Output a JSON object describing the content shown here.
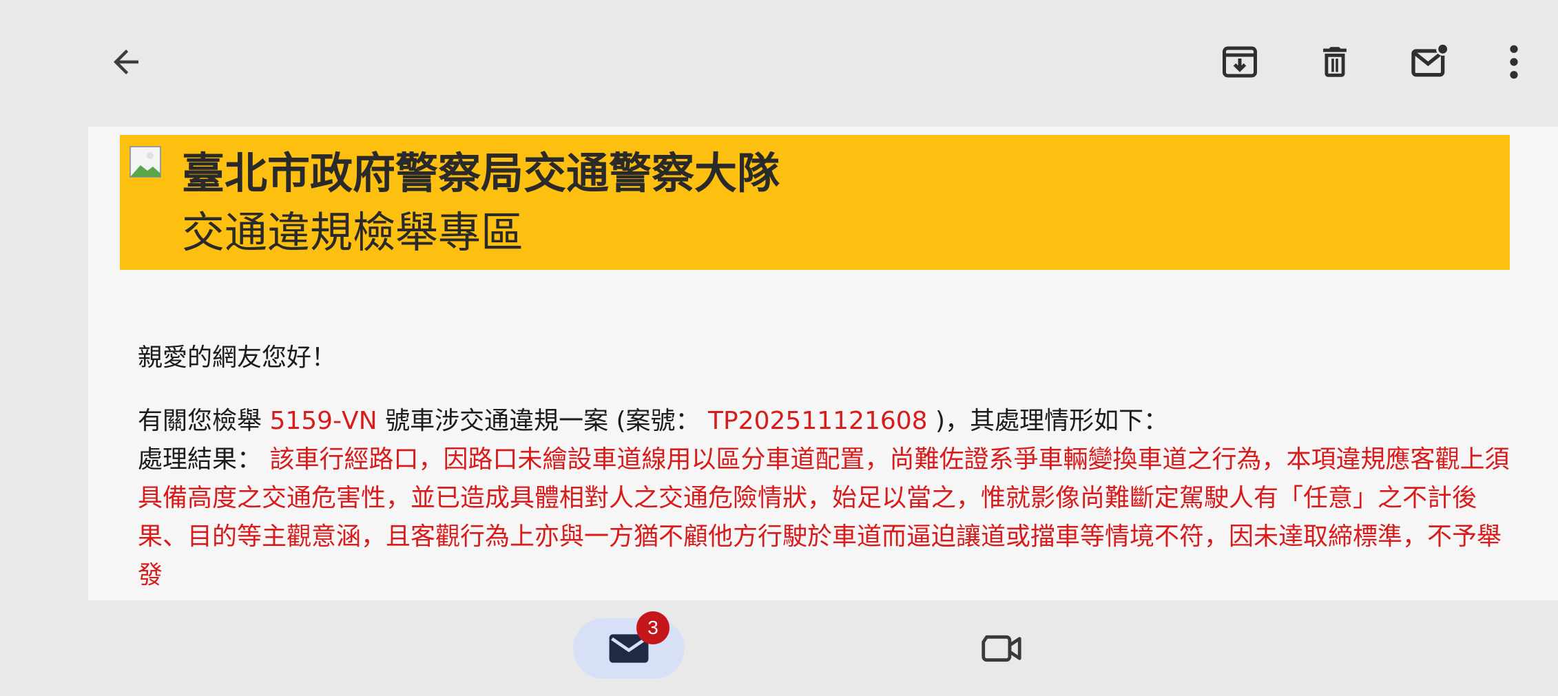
{
  "toolbar": {
    "back_icon": "arrow-back-icon",
    "archive_icon": "archive-icon",
    "delete_icon": "delete-icon",
    "mark_unread_icon": "mark-unread-icon",
    "more_icon": "more-vert-icon"
  },
  "banner": {
    "background_color": "#fdbf10",
    "title": "臺北市政府警察局交通警察大隊",
    "subtitle": "交通違規檢舉專區"
  },
  "email": {
    "greeting": "親愛的網友您好！",
    "line1_prefix": "有關您檢舉 ",
    "plate_number": "5159-VN",
    "line1_mid": " 號車涉交通違規一案 (案號： ",
    "case_number": "TP202511121608",
    "line1_suffix": " )，其處理情形如下：",
    "result_label": "處理結果： ",
    "result_text": "該車行經路口，因路口未繪設車道線用以區分車道配置，尚難佐證系爭車輛變換車道之行為，本項違規應客觀上須具備高度之交通危害性，並已造成具體相對人之交通危險情狀，始足以當之，惟就影像尚難斷定駕駛人有「任意」之不計後果、目的等主觀意涵，且客觀行為上亦與一方猶不顧他方行駛於車道而逼迫讓道或擋車等情境不符，因未達取締標準，不予舉發",
    "highlight_color": "#d81b1b"
  },
  "bottom_nav": {
    "mail_icon": "mail-icon",
    "mail_badge": "3",
    "meet_icon": "videocam-icon",
    "active_pill_color": "#d8e0f7"
  }
}
